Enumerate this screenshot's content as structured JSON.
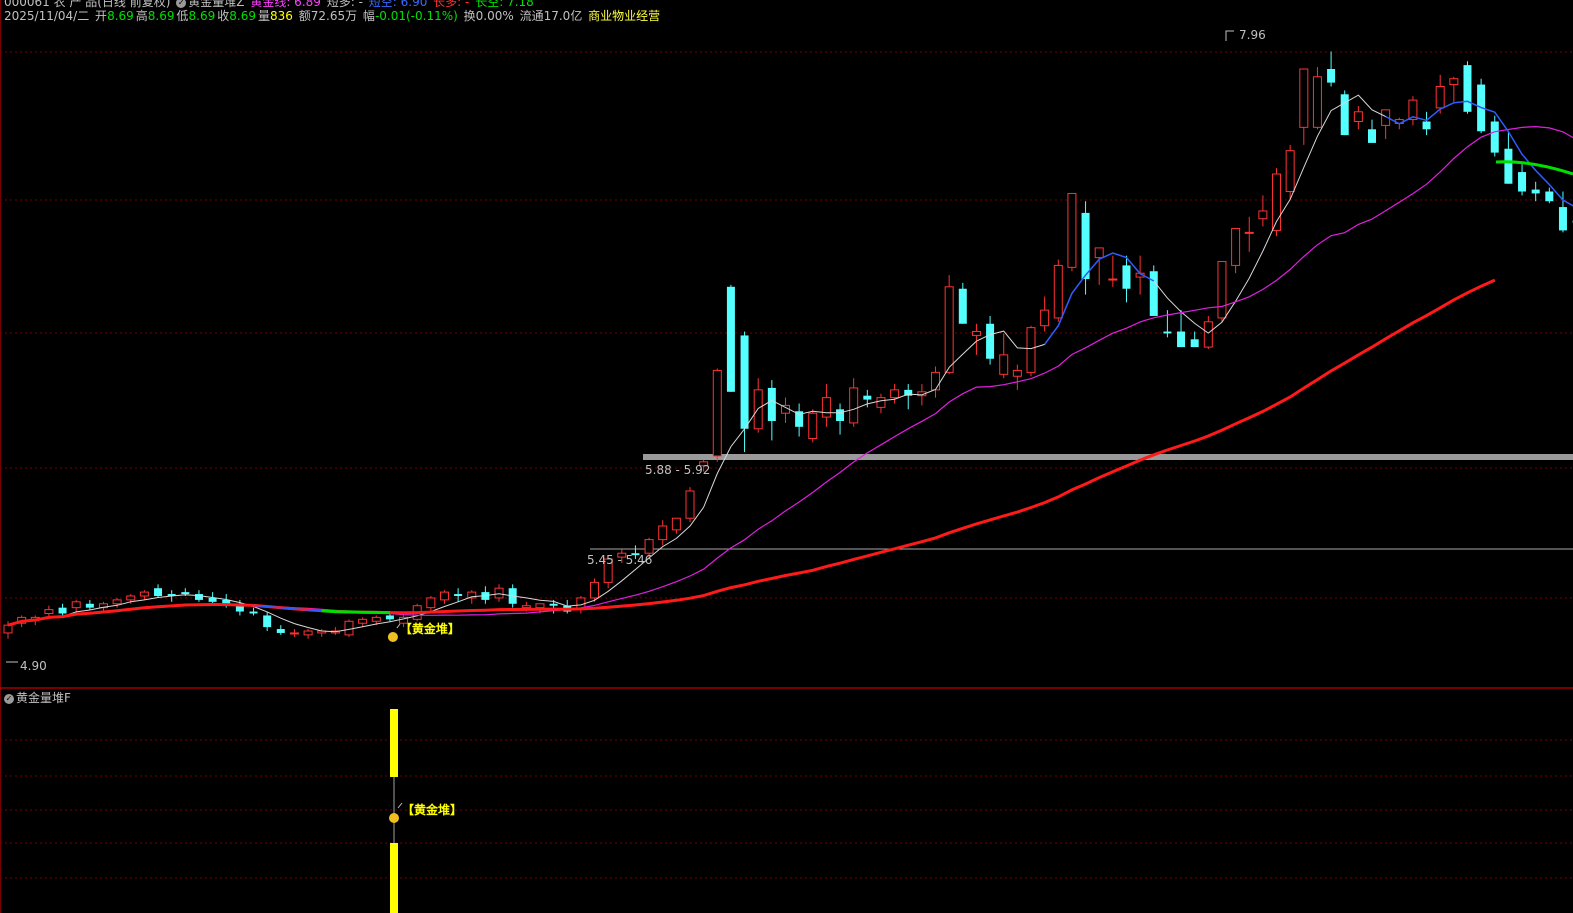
{
  "header": {
    "code_title": "000061 农 产 品(日线 前复权)",
    "indicator_name": "黄金量堆Z",
    "gold_line": "黄金线: 6.89",
    "short_long": "短多: -",
    "short_empty": "短空: 6.90",
    "long_long": "长多: -",
    "long_empty": "长空: 7.18"
  },
  "quote": {
    "date": "2025/11/04/二",
    "open_label": "开",
    "open": "8.69",
    "high_label": "高",
    "high": "8.69",
    "low_label": "低",
    "low": "8.69",
    "close_label": "收",
    "close": "8.69",
    "volume_label": "量",
    "volume": "836",
    "amount": "额72.65万",
    "change_label": "幅",
    "change": "-0.01(-0.11%)",
    "turnover": "换0.00%",
    "float_cap": "流通17.0亿",
    "sector": "商业物业经营"
  },
  "lower_panel": {
    "title": "黄金量堆F",
    "signal_label": "【黄金堆】"
  },
  "annotations": {
    "high_price": "7.96",
    "low_price": "4.90",
    "zone_upper": "5.88 - 5.92",
    "zone_lower": "5.45 - 5.46",
    "signal_label": "【黄金堆】"
  },
  "colors": {
    "bg": "#000000",
    "grid": "#7a0000",
    "up": "#ff3232",
    "down": "#54ffff",
    "ma_white": "#d8d8d8",
    "ma_magenta": "#e020e0",
    "ma_red": "#ff1a1a",
    "ma_blue": "#2a5cff",
    "ma_green": "#00e000",
    "signal": "#ffff00",
    "zone_upper": "#9a9a9a",
    "zone_lower": "#a8a8a8"
  },
  "chart_data": {
    "type": "candlestick",
    "price_range": [
      4.8,
      8.05
    ],
    "candles": [
      [
        4.97,
        5.03,
        4.94,
        5.01
      ],
      [
        5.02,
        5.06,
        5.0,
        5.05
      ],
      [
        5.04,
        5.06,
        5.01,
        5.05
      ],
      [
        5.07,
        5.11,
        5.05,
        5.09
      ],
      [
        5.1,
        5.12,
        5.06,
        5.07
      ],
      [
        5.1,
        5.14,
        5.08,
        5.13
      ],
      [
        5.12,
        5.14,
        5.09,
        5.1
      ],
      [
        5.1,
        5.13,
        5.08,
        5.12
      ],
      [
        5.12,
        5.15,
        5.1,
        5.14
      ],
      [
        5.14,
        5.17,
        5.12,
        5.16
      ],
      [
        5.16,
        5.19,
        5.14,
        5.18
      ],
      [
        5.2,
        5.22,
        5.15,
        5.16
      ],
      [
        5.17,
        5.19,
        5.13,
        5.16
      ],
      [
        5.18,
        5.2,
        5.16,
        5.17
      ],
      [
        5.17,
        5.19,
        5.13,
        5.14
      ],
      [
        5.15,
        5.18,
        5.12,
        5.13
      ],
      [
        5.14,
        5.17,
        5.1,
        5.11
      ],
      [
        5.12,
        5.14,
        5.06,
        5.08
      ],
      [
        5.08,
        5.1,
        5.06,
        5.07
      ],
      [
        5.06,
        5.08,
        4.98,
        5.0
      ],
      [
        4.99,
        5.01,
        4.96,
        4.97
      ],
      [
        4.97,
        4.99,
        4.95,
        4.97
      ],
      [
        4.96,
        4.99,
        4.94,
        4.98
      ],
      [
        4.97,
        4.99,
        4.95,
        4.98
      ],
      [
        4.97,
        5.0,
        4.96,
        4.98
      ],
      [
        4.96,
        5.04,
        4.95,
        5.03
      ],
      [
        5.02,
        5.05,
        5.0,
        5.04
      ],
      [
        5.03,
        5.06,
        5.01,
        5.05
      ],
      [
        5.06,
        5.08,
        5.03,
        5.04
      ],
      [
        5.02,
        5.06,
        5.0,
        5.05
      ],
      [
        5.04,
        5.12,
        5.03,
        5.11
      ],
      [
        5.1,
        5.16,
        5.08,
        5.15
      ],
      [
        5.14,
        5.19,
        5.12,
        5.18
      ],
      [
        5.17,
        5.2,
        5.13,
        5.16
      ],
      [
        5.15,
        5.19,
        5.12,
        5.18
      ],
      [
        5.18,
        5.21,
        5.12,
        5.14
      ],
      [
        5.15,
        5.22,
        5.13,
        5.2
      ],
      [
        5.2,
        5.22,
        5.1,
        5.12
      ],
      [
        5.1,
        5.13,
        5.08,
        5.11
      ],
      [
        5.1,
        5.12,
        5.07,
        5.12
      ],
      [
        5.12,
        5.14,
        5.07,
        5.11
      ],
      [
        5.11,
        5.14,
        5.07,
        5.08
      ],
      [
        5.09,
        5.16,
        5.07,
        5.15
      ],
      [
        5.15,
        5.25,
        5.13,
        5.23
      ],
      [
        5.23,
        5.36,
        5.2,
        5.35
      ],
      [
        5.36,
        5.4,
        5.33,
        5.38
      ],
      [
        5.38,
        5.42,
        5.35,
        5.37
      ],
      [
        5.38,
        5.46,
        5.36,
        5.45
      ],
      [
        5.45,
        5.55,
        5.42,
        5.52
      ],
      [
        5.5,
        5.56,
        5.48,
        5.56
      ],
      [
        5.56,
        5.72,
        5.54,
        5.7
      ],
      [
        5.83,
        5.86,
        5.8,
        5.85
      ],
      [
        5.88,
        6.33,
        5.85,
        6.32
      ],
      [
        6.75,
        6.76,
        6.21,
        6.21
      ],
      [
        6.5,
        6.52,
        5.9,
        6.02
      ],
      [
        6.02,
        6.28,
        6.0,
        6.22
      ],
      [
        6.23,
        6.27,
        5.96,
        6.06
      ],
      [
        6.1,
        6.18,
        6.05,
        6.14
      ],
      [
        6.11,
        6.15,
        5.98,
        6.03
      ],
      [
        5.97,
        6.12,
        5.95,
        6.1
      ],
      [
        6.08,
        6.25,
        6.03,
        6.18
      ],
      [
        6.12,
        6.15,
        5.99,
        6.06
      ],
      [
        6.05,
        6.28,
        6.03,
        6.23
      ],
      [
        6.19,
        6.22,
        6.13,
        6.17
      ],
      [
        6.13,
        6.2,
        6.1,
        6.18
      ],
      [
        6.18,
        6.25,
        6.15,
        6.22
      ],
      [
        6.22,
        6.25,
        6.12,
        6.19
      ],
      [
        6.19,
        6.25,
        6.14,
        6.21
      ],
      [
        6.22,
        6.34,
        6.18,
        6.31
      ],
      [
        6.31,
        6.81,
        6.3,
        6.75
      ],
      [
        6.74,
        6.77,
        6.56,
        6.56
      ],
      [
        6.5,
        6.56,
        6.4,
        6.52
      ],
      [
        6.56,
        6.6,
        6.35,
        6.38
      ],
      [
        6.3,
        6.51,
        6.28,
        6.4
      ],
      [
        6.29,
        6.35,
        6.22,
        6.32
      ],
      [
        6.31,
        6.55,
        6.29,
        6.54
      ],
      [
        6.55,
        6.7,
        6.52,
        6.63
      ],
      [
        6.59,
        6.89,
        6.57,
        6.86
      ],
      [
        6.85,
        7.12,
        6.83,
        7.23
      ],
      [
        7.13,
        7.19,
        6.71,
        6.79
      ],
      [
        6.9,
        6.95,
        6.76,
        6.95
      ],
      [
        6.79,
        6.91,
        6.75,
        6.79
      ],
      [
        6.86,
        6.91,
        6.67,
        6.74
      ],
      [
        6.8,
        6.91,
        6.71,
        6.82
      ],
      [
        6.83,
        6.86,
        6.6,
        6.6
      ],
      [
        6.52,
        6.63,
        6.49,
        6.51
      ],
      [
        6.52,
        6.63,
        6.46,
        6.44
      ],
      [
        6.48,
        6.52,
        6.44,
        6.44
      ],
      [
        6.44,
        6.6,
        6.43,
        6.57
      ],
      [
        6.59,
        6.83,
        6.57,
        6.88
      ],
      [
        6.86,
        7.05,
        6.82,
        7.05
      ],
      [
        7.03,
        7.11,
        6.93,
        7.03
      ],
      [
        7.1,
        7.22,
        7.06,
        7.14
      ],
      [
        7.04,
        7.36,
        7.01,
        7.33
      ],
      [
        7.24,
        7.48,
        7.2,
        7.45
      ],
      [
        7.57,
        7.86,
        7.48,
        7.87
      ],
      [
        7.57,
        7.88,
        7.56,
        7.83
      ],
      [
        7.87,
        7.96,
        7.78,
        7.8
      ],
      [
        7.74,
        7.76,
        7.53,
        7.53
      ],
      [
        7.6,
        7.68,
        7.56,
        7.65
      ],
      [
        7.56,
        7.61,
        7.49,
        7.49
      ],
      [
        7.58,
        7.64,
        7.51,
        7.66
      ],
      [
        7.59,
        7.62,
        7.56,
        7.61
      ],
      [
        7.61,
        7.73,
        7.58,
        7.71
      ],
      [
        7.6,
        7.65,
        7.53,
        7.56
      ],
      [
        7.67,
        7.84,
        7.64,
        7.78
      ],
      [
        7.79,
        7.83,
        7.7,
        7.82
      ],
      [
        7.89,
        7.91,
        7.64,
        7.65
      ],
      [
        7.79,
        7.82,
        7.54,
        7.55
      ],
      [
        7.6,
        7.63,
        7.42,
        7.44
      ],
      [
        7.46,
        7.55,
        7.28,
        7.28
      ],
      [
        7.34,
        7.38,
        7.22,
        7.24
      ],
      [
        7.25,
        7.29,
        7.19,
        7.23
      ],
      [
        7.24,
        7.26,
        7.18,
        7.19
      ],
      [
        7.16,
        7.24,
        7.03,
        7.04
      ],
      [
        7.09,
        7.18,
        7.06,
        7.08
      ],
      [
        7.12,
        7.15,
        7.03,
        7.1
      ],
      [
        7.09,
        7.11,
        7.05,
        7.1
      ],
      [
        7.12,
        7.26,
        7.02,
        7.25
      ],
      [
        7.23,
        7.26,
        7.04,
        7.04
      ],
      [
        7.03,
        7.08,
        7.0,
        7.07
      ],
      [
        7.08,
        7.12,
        6.98,
        7.05
      ],
      [
        7.01,
        7.04,
        6.82,
        6.82
      ]
    ]
  }
}
